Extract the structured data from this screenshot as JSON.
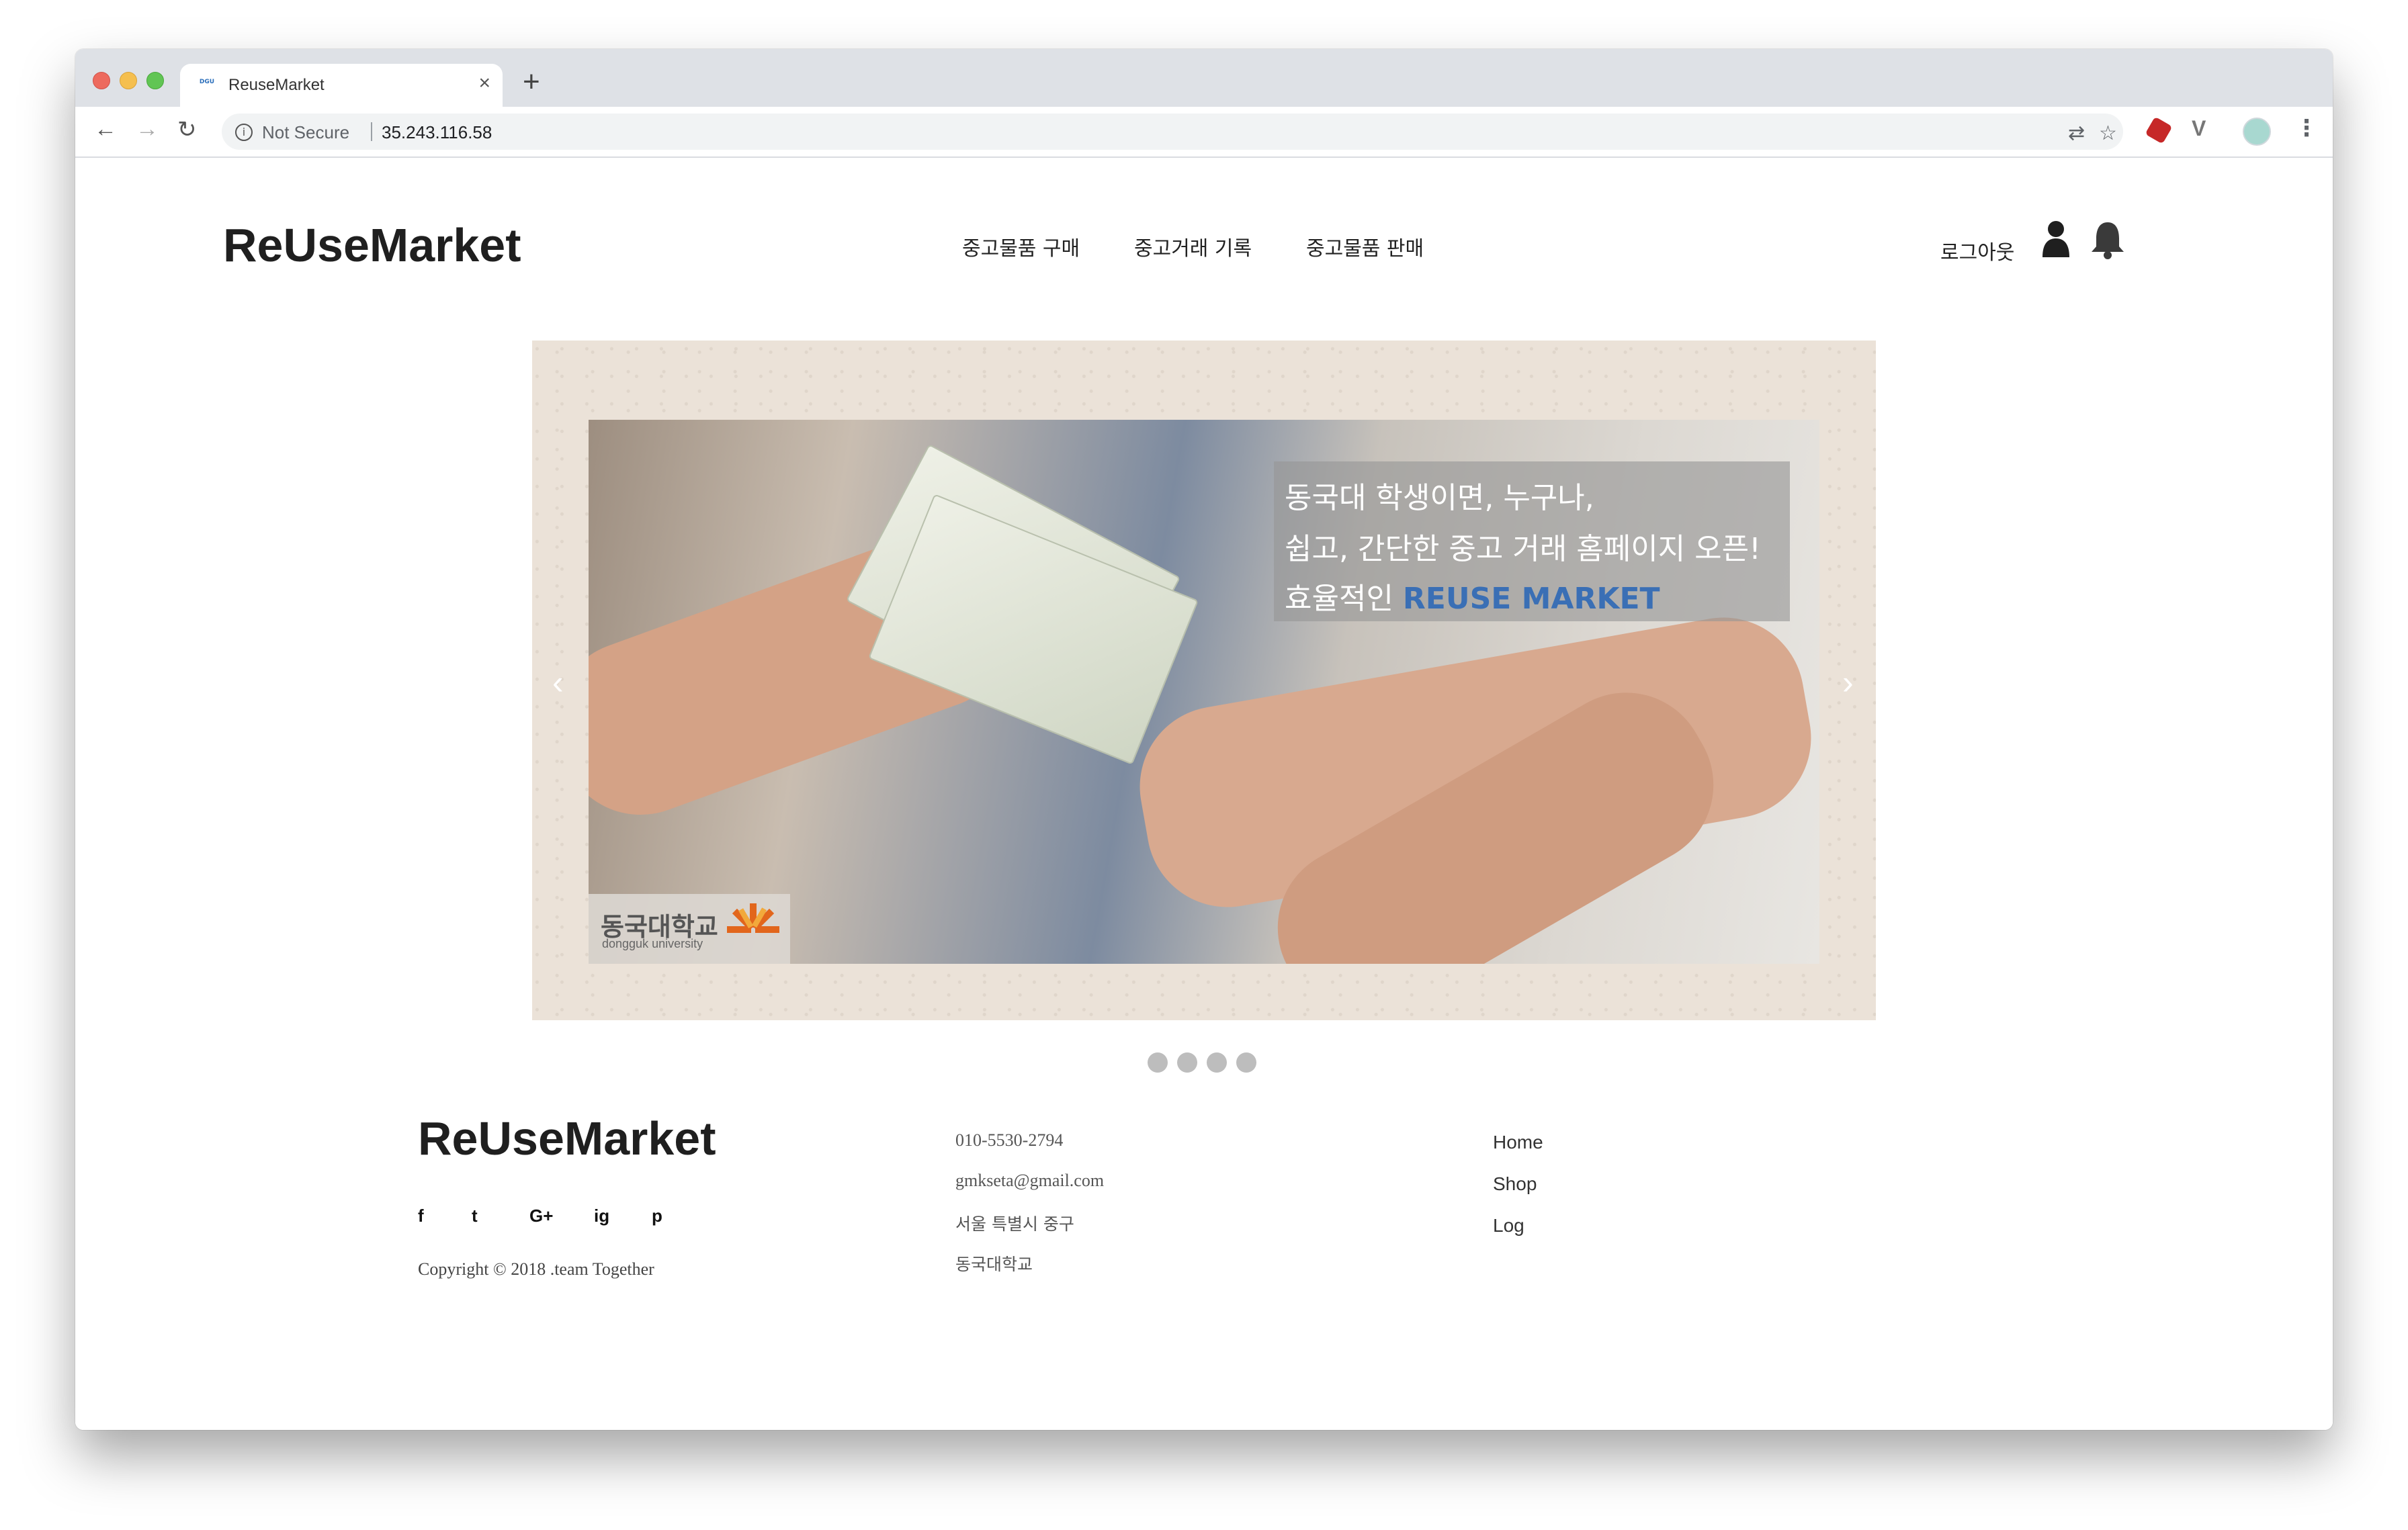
{
  "browser": {
    "tab_title": "ReuseMarket",
    "favicon_text": "DGU",
    "security_label": "Not Secure",
    "url": "35.243.116.58"
  },
  "header": {
    "logo": "ReUseMarket",
    "nav": [
      "중고물품 구매",
      "중고거래 기록",
      "중고물품 판매"
    ],
    "logout": "로그아웃"
  },
  "carousel": {
    "caption_line1": "동국대 학생이면, 누구나,",
    "caption_line2": "쉽고, 간단한 중고 거래 홈페이지 오픈!",
    "caption_line3_prefix": "효율적인 ",
    "caption_line3_brand": "REUSE MARKET",
    "university_name": "동국대학교",
    "university_sub": "dongguk university",
    "prev_arrow": "‹",
    "next_arrow": "›",
    "indicator_count": 4
  },
  "footer": {
    "logo": "ReUseMarket",
    "social_icons": [
      "f",
      "t",
      "G+",
      "ig",
      "p"
    ],
    "copyright": "Copyright © 2018 .team Together",
    "phone": "010-5530-2794",
    "email": "gmkseta@gmail.com",
    "address": "서울 특별시 중구",
    "school": "동국대학교",
    "links": [
      "Home",
      "Shop",
      "Log"
    ]
  }
}
